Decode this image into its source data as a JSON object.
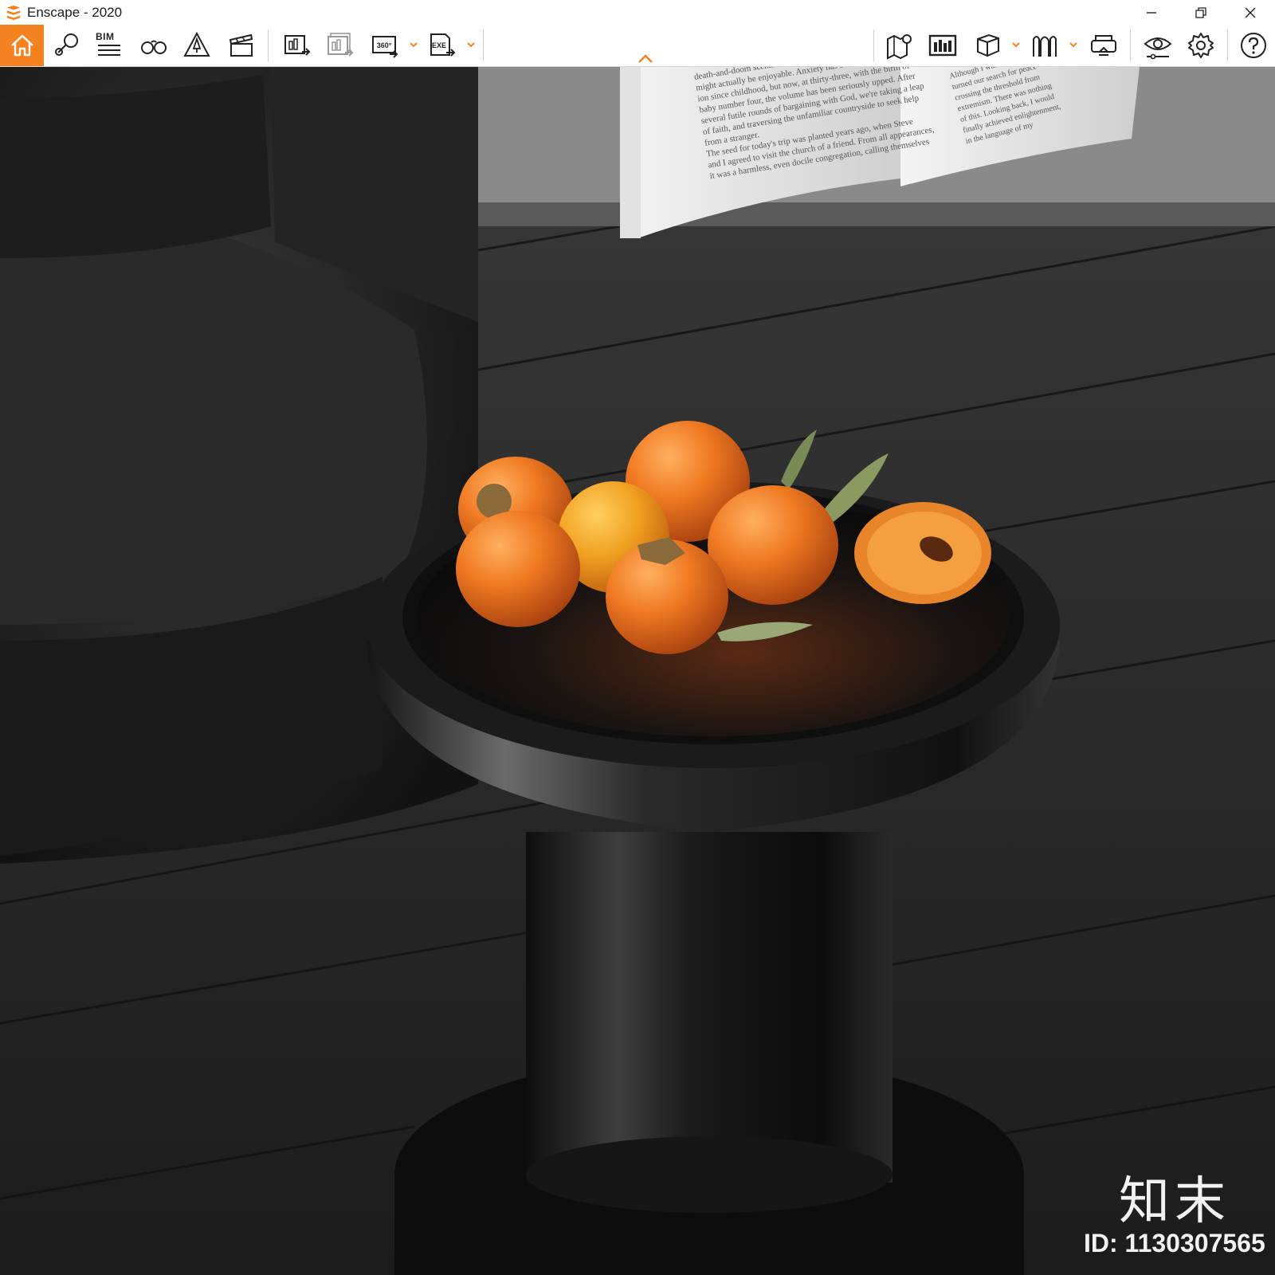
{
  "window": {
    "title": "Enscape - 2020",
    "brand_color": "#f58220"
  },
  "toolbar": {
    "home_icon": "home-icon",
    "bim_label": "BIM",
    "icons_left": [
      "home-icon",
      "location-pin-icon",
      "bim-list-icon",
      "binoculars-icon",
      "artificial-light-icon",
      "clapperboard-icon",
      "render-screenshot-icon",
      "batch-render-icon",
      "360-panorama-icon",
      "export-exe-icon"
    ],
    "icons_right": [
      "map-pin-icon",
      "view-management-icon",
      "cube-icon",
      "asset-library-icon",
      "vr-headset-icon",
      "visual-settings-icon",
      "gear-icon",
      "help-icon"
    ],
    "panorama_label": "360°",
    "exe_label": "EXE"
  },
  "viewport": {
    "book_lines_left": [
      "death-and-doom scenarios clogging my",
      "might actually be enjoyable. Anxiety has been a faithful compan",
      "ion since childhood, but now, at thirty-three, with the birth of",
      "baby number four, the volume has been seriously upped. After",
      "several futile rounds of bargaining with God, we're taking a leap",
      "of faith, and traversing the unfamiliar countryside to seek help",
      "from a stranger.",
      "The seed for today's trip was planted years ago, when Steve",
      "and I agreed to visit the church of a friend. From all appearances,",
      "it was a harmless, even docile congregation, calling themselves"
    ],
    "book_lines_right": [
      "Although I was",
      "turned our search for peace",
      "crossing the threshold from",
      "extremism. There was nothing",
      "of this. Looking back, I would",
      "finally achieved enlightenment,",
      "in the language of my"
    ],
    "brand_mark": "知末",
    "asset_id": "ID: 1130307565"
  }
}
